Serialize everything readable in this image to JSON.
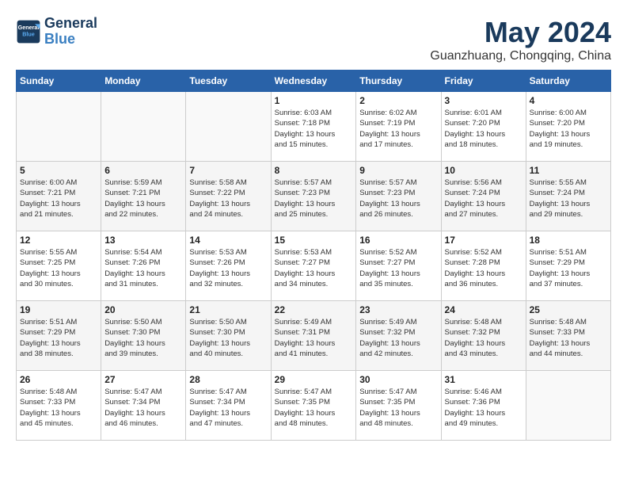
{
  "logo": {
    "line1": "General",
    "line2": "Blue"
  },
  "title": "May 2024",
  "location": "Guanzhuang, Chongqing, China",
  "days_header": [
    "Sunday",
    "Monday",
    "Tuesday",
    "Wednesday",
    "Thursday",
    "Friday",
    "Saturday"
  ],
  "weeks": [
    [
      {
        "day": "",
        "info": ""
      },
      {
        "day": "",
        "info": ""
      },
      {
        "day": "",
        "info": ""
      },
      {
        "day": "1",
        "info": "Sunrise: 6:03 AM\nSunset: 7:18 PM\nDaylight: 13 hours\nand 15 minutes."
      },
      {
        "day": "2",
        "info": "Sunrise: 6:02 AM\nSunset: 7:19 PM\nDaylight: 13 hours\nand 17 minutes."
      },
      {
        "day": "3",
        "info": "Sunrise: 6:01 AM\nSunset: 7:20 PM\nDaylight: 13 hours\nand 18 minutes."
      },
      {
        "day": "4",
        "info": "Sunrise: 6:00 AM\nSunset: 7:20 PM\nDaylight: 13 hours\nand 19 minutes."
      }
    ],
    [
      {
        "day": "5",
        "info": "Sunrise: 6:00 AM\nSunset: 7:21 PM\nDaylight: 13 hours\nand 21 minutes."
      },
      {
        "day": "6",
        "info": "Sunrise: 5:59 AM\nSunset: 7:21 PM\nDaylight: 13 hours\nand 22 minutes."
      },
      {
        "day": "7",
        "info": "Sunrise: 5:58 AM\nSunset: 7:22 PM\nDaylight: 13 hours\nand 24 minutes."
      },
      {
        "day": "8",
        "info": "Sunrise: 5:57 AM\nSunset: 7:23 PM\nDaylight: 13 hours\nand 25 minutes."
      },
      {
        "day": "9",
        "info": "Sunrise: 5:57 AM\nSunset: 7:23 PM\nDaylight: 13 hours\nand 26 minutes."
      },
      {
        "day": "10",
        "info": "Sunrise: 5:56 AM\nSunset: 7:24 PM\nDaylight: 13 hours\nand 27 minutes."
      },
      {
        "day": "11",
        "info": "Sunrise: 5:55 AM\nSunset: 7:24 PM\nDaylight: 13 hours\nand 29 minutes."
      }
    ],
    [
      {
        "day": "12",
        "info": "Sunrise: 5:55 AM\nSunset: 7:25 PM\nDaylight: 13 hours\nand 30 minutes."
      },
      {
        "day": "13",
        "info": "Sunrise: 5:54 AM\nSunset: 7:26 PM\nDaylight: 13 hours\nand 31 minutes."
      },
      {
        "day": "14",
        "info": "Sunrise: 5:53 AM\nSunset: 7:26 PM\nDaylight: 13 hours\nand 32 minutes."
      },
      {
        "day": "15",
        "info": "Sunrise: 5:53 AM\nSunset: 7:27 PM\nDaylight: 13 hours\nand 34 minutes."
      },
      {
        "day": "16",
        "info": "Sunrise: 5:52 AM\nSunset: 7:27 PM\nDaylight: 13 hours\nand 35 minutes."
      },
      {
        "day": "17",
        "info": "Sunrise: 5:52 AM\nSunset: 7:28 PM\nDaylight: 13 hours\nand 36 minutes."
      },
      {
        "day": "18",
        "info": "Sunrise: 5:51 AM\nSunset: 7:29 PM\nDaylight: 13 hours\nand 37 minutes."
      }
    ],
    [
      {
        "day": "19",
        "info": "Sunrise: 5:51 AM\nSunset: 7:29 PM\nDaylight: 13 hours\nand 38 minutes."
      },
      {
        "day": "20",
        "info": "Sunrise: 5:50 AM\nSunset: 7:30 PM\nDaylight: 13 hours\nand 39 minutes."
      },
      {
        "day": "21",
        "info": "Sunrise: 5:50 AM\nSunset: 7:30 PM\nDaylight: 13 hours\nand 40 minutes."
      },
      {
        "day": "22",
        "info": "Sunrise: 5:49 AM\nSunset: 7:31 PM\nDaylight: 13 hours\nand 41 minutes."
      },
      {
        "day": "23",
        "info": "Sunrise: 5:49 AM\nSunset: 7:32 PM\nDaylight: 13 hours\nand 42 minutes."
      },
      {
        "day": "24",
        "info": "Sunrise: 5:48 AM\nSunset: 7:32 PM\nDaylight: 13 hours\nand 43 minutes."
      },
      {
        "day": "25",
        "info": "Sunrise: 5:48 AM\nSunset: 7:33 PM\nDaylight: 13 hours\nand 44 minutes."
      }
    ],
    [
      {
        "day": "26",
        "info": "Sunrise: 5:48 AM\nSunset: 7:33 PM\nDaylight: 13 hours\nand 45 minutes."
      },
      {
        "day": "27",
        "info": "Sunrise: 5:47 AM\nSunset: 7:34 PM\nDaylight: 13 hours\nand 46 minutes."
      },
      {
        "day": "28",
        "info": "Sunrise: 5:47 AM\nSunset: 7:34 PM\nDaylight: 13 hours\nand 47 minutes."
      },
      {
        "day": "29",
        "info": "Sunrise: 5:47 AM\nSunset: 7:35 PM\nDaylight: 13 hours\nand 48 minutes."
      },
      {
        "day": "30",
        "info": "Sunrise: 5:47 AM\nSunset: 7:35 PM\nDaylight: 13 hours\nand 48 minutes."
      },
      {
        "day": "31",
        "info": "Sunrise: 5:46 AM\nSunset: 7:36 PM\nDaylight: 13 hours\nand 49 minutes."
      },
      {
        "day": "",
        "info": ""
      }
    ]
  ]
}
